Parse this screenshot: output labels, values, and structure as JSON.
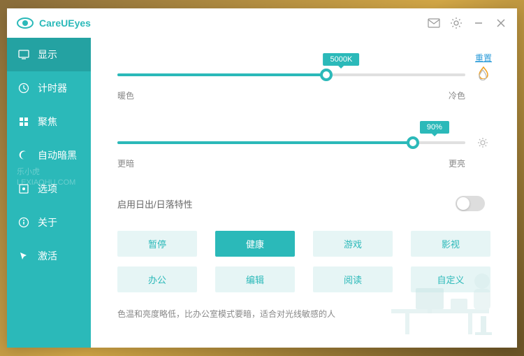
{
  "app": {
    "title": "CareUEyes"
  },
  "sidebar": {
    "items": [
      {
        "label": "显示"
      },
      {
        "label": "计时器"
      },
      {
        "label": "聚焦"
      },
      {
        "label": "自动暗黑"
      },
      {
        "label": "选项"
      },
      {
        "label": "关于"
      },
      {
        "label": "激活"
      }
    ]
  },
  "main": {
    "reset": "重置",
    "temp_slider": {
      "value": "5000K",
      "percent": 60,
      "left_label": "暖色",
      "right_label": "冷色"
    },
    "bright_slider": {
      "value": "90%",
      "percent": 85,
      "left_label": "更暗",
      "right_label": "更亮"
    },
    "sunrise_toggle": {
      "label": "启用日出/日落特性",
      "on": false
    },
    "modes": [
      {
        "label": "暂停"
      },
      {
        "label": "健康",
        "active": true
      },
      {
        "label": "游戏"
      },
      {
        "label": "影视"
      },
      {
        "label": "办公"
      },
      {
        "label": "编辑"
      },
      {
        "label": "阅读"
      },
      {
        "label": "自定义"
      }
    ],
    "description": "色温和亮度略低，比办公室模式要暗，适合对光线敏感的人"
  },
  "watermark": {
    "line1": "乐小虎",
    "line2": "LEXIAOHU.COM"
  }
}
